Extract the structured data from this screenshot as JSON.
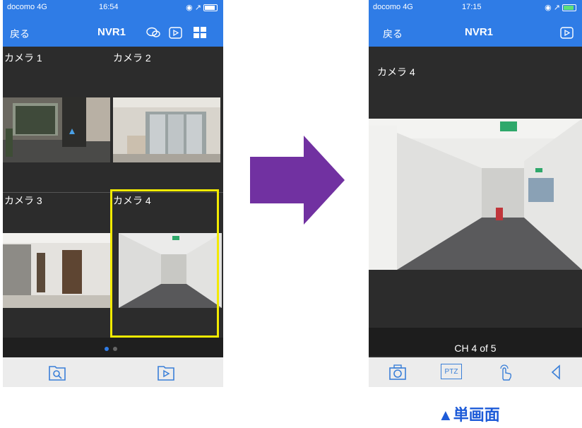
{
  "left_screen": {
    "status": {
      "carrier": "docomo 4G",
      "time": "16:54"
    },
    "header": {
      "back": "戻る",
      "title": "NVR1"
    },
    "cameras": [
      "カメラ 1",
      "カメラ 2",
      "カメラ 3",
      "カメラ 4"
    ],
    "page_indicator": {
      "current": 1,
      "total": 2
    }
  },
  "right_screen": {
    "status": {
      "carrier": "docomo 4G",
      "time": "17:15"
    },
    "header": {
      "back": "戻る",
      "title": "NVR1"
    },
    "camera_label": "カメラ 4",
    "channel_text": "CH 4 of 5",
    "ptz_label": "PTZ"
  },
  "caption": "▲単画面",
  "colors": {
    "header_blue": "#2f7ce6",
    "highlight_yellow": "#f2ea00",
    "arrow_purple": "#7131a1",
    "caption_blue": "#1d5bd8"
  },
  "icons": [
    "chat-icon",
    "playback-icon",
    "grid-icon",
    "search-icon",
    "camera-icon",
    "touch-icon",
    "speaker-icon"
  ]
}
